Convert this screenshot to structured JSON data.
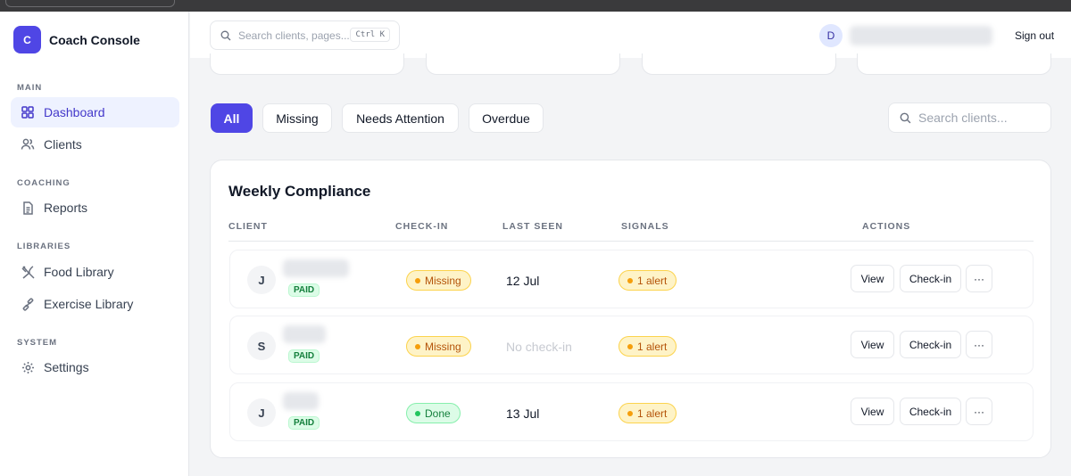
{
  "brand": {
    "logo_letter": "C",
    "name": "Coach Console"
  },
  "sidebar": {
    "sections": [
      {
        "label": "MAIN"
      },
      {
        "label": "COACHING"
      },
      {
        "label": "LIBRARIES"
      },
      {
        "label": "SYSTEM"
      }
    ],
    "items": [
      {
        "label": "Dashboard",
        "icon": "grid-icon",
        "active": true
      },
      {
        "label": "Clients",
        "icon": "users-icon"
      },
      {
        "label": "Reports",
        "icon": "document-icon"
      },
      {
        "label": "Food Library",
        "icon": "utensils-icon"
      },
      {
        "label": "Exercise Library",
        "icon": "dumbbell-icon"
      },
      {
        "label": "Settings",
        "icon": "gear-icon"
      }
    ]
  },
  "header": {
    "search_placeholder": "Search clients, pages...",
    "shortcut": "Ctrl K",
    "user_initial": "D",
    "sign_out": "Sign out"
  },
  "filters": {
    "tabs": [
      {
        "label": "All",
        "active": true
      },
      {
        "label": "Missing"
      },
      {
        "label": "Needs Attention"
      },
      {
        "label": "Overdue"
      }
    ],
    "search_placeholder": "Search clients..."
  },
  "compliance": {
    "title": "Weekly Compliance",
    "columns": [
      "CLIENT",
      "CHECK-IN",
      "LAST SEEN",
      "SIGNALS",
      "ACTIONS"
    ],
    "rows": [
      {
        "initial": "J",
        "plan": "PAID",
        "checkin": "Missing",
        "last_seen": "12 Jul",
        "signal": "1 alert"
      },
      {
        "initial": "S",
        "plan": "PAID",
        "checkin": "Missing",
        "last_seen": "No check-in",
        "signal": "1 alert"
      },
      {
        "initial": "J",
        "plan": "PAID",
        "checkin": "Done",
        "last_seen": "13 Jul",
        "signal": "1 alert"
      }
    ],
    "actions": {
      "view": "View",
      "checkin": "Check-in",
      "more": "···"
    }
  },
  "colors": {
    "accent": "#4f46e5",
    "warning": "#f59e0b",
    "success": "#22c55e"
  }
}
